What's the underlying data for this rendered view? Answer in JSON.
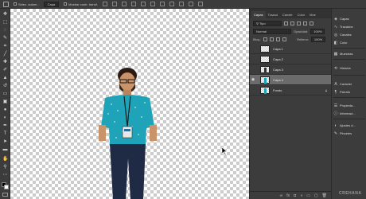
{
  "options_bar": {
    "autoselect_label": "Selec. autom.:",
    "autoselect_value": "Capa",
    "transform_label": "Mostrar contr. transf."
  },
  "tools": [
    "move-tool",
    "marquee-tool",
    "lasso-tool",
    "quick-select-tool",
    "crop-tool",
    "eyedropper-tool",
    "healing-tool",
    "brush-tool",
    "stamp-tool",
    "history-brush-tool",
    "eraser-tool",
    "gradient-tool",
    "blur-tool",
    "dodge-tool",
    "pen-tool",
    "type-tool",
    "path-select-tool",
    "shape-tool",
    "hand-tool",
    "zoom-tool",
    "color-swatches"
  ],
  "layers_panel": {
    "tabs": [
      "Capas",
      "Trazad",
      "Canale",
      "Color",
      "Mue"
    ],
    "filter_label": "Tipo",
    "blend_mode": "Normal",
    "opacity_label": "Opacidad:",
    "opacity_value": "100%",
    "lock_label": "Bloq.:",
    "fill_label": "Relleno:",
    "fill_value": "100%",
    "layers": [
      {
        "name": "Capa 1",
        "selected": false,
        "visible": false,
        "locked": false
      },
      {
        "name": "Capa 2",
        "selected": false,
        "visible": false,
        "locked": false
      },
      {
        "name": "Capa 3",
        "selected": false,
        "visible": false,
        "locked": false
      },
      {
        "name": "Capa 4",
        "selected": true,
        "visible": true,
        "locked": false
      },
      {
        "name": "Fondo",
        "selected": false,
        "visible": false,
        "locked": true
      }
    ]
  },
  "dock": [
    {
      "label": "Capas",
      "icon": "layers-icon"
    },
    {
      "label": "Trazados",
      "icon": "paths-icon"
    },
    {
      "label": "Canales",
      "icon": "channels-icon"
    },
    {
      "label": "Color",
      "icon": "color-icon"
    },
    {
      "label": "Muestras",
      "icon": "swatches-icon"
    },
    {
      "label": "Historia",
      "icon": "history-icon"
    },
    {
      "label": "Carácter",
      "icon": "character-icon"
    },
    {
      "label": "Párrafo",
      "icon": "paragraph-icon"
    },
    {
      "label": "Propieda...",
      "icon": "properties-icon"
    },
    {
      "label": "Informaci...",
      "icon": "info-icon"
    },
    {
      "label": "Ajustes d...",
      "icon": "adjustments-icon"
    },
    {
      "label": "Pinceles",
      "icon": "brushes-icon"
    }
  ],
  "watermark": "CREHANA",
  "colors": {
    "shirt": "#1fa3b8",
    "ui_dark": "#3c3c3c",
    "selected_layer": "#6b6b6b"
  }
}
